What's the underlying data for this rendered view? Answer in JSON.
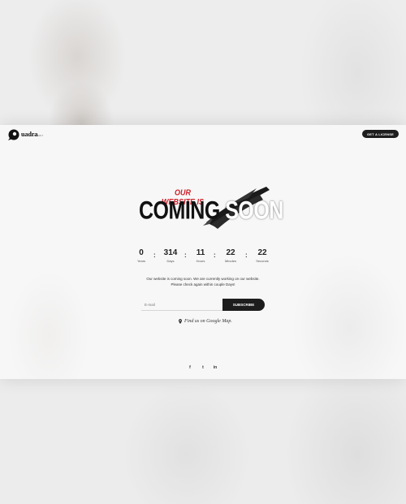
{
  "brand": {
    "logo_text": "uadra",
    "logo_subtext": "CREATIVE AGENCY"
  },
  "header": {
    "license_button": "GET A LICENSE"
  },
  "hero": {
    "small_text": "OUR WEBSITE IS",
    "big_text_dark": "COMING ",
    "big_text_light": "SOON",
    "accent_color": "#d0202a"
  },
  "countdown": [
    {
      "value": "0",
      "label": "Years"
    },
    {
      "value": "314",
      "label": "Days"
    },
    {
      "value": "11",
      "label": "Hours"
    },
    {
      "value": "22",
      "label": "Minutes"
    },
    {
      "value": "22",
      "label": "Seconds"
    }
  ],
  "countdown_separator": ":",
  "description": {
    "line1": "Our website is coming soon. We are currently working on our website.",
    "line2": "Please check again within couple Days!"
  },
  "subscribe": {
    "email_placeholder": "E-mail",
    "button_label": "SUBSCRIBE"
  },
  "map": {
    "icon": "map-pin-icon",
    "link_text": "Find us on Google Map."
  },
  "social": [
    {
      "icon": "facebook-icon",
      "glyph": "f"
    },
    {
      "icon": "twitter-icon",
      "glyph": "t"
    },
    {
      "icon": "linkedin-icon",
      "glyph": "in"
    }
  ]
}
